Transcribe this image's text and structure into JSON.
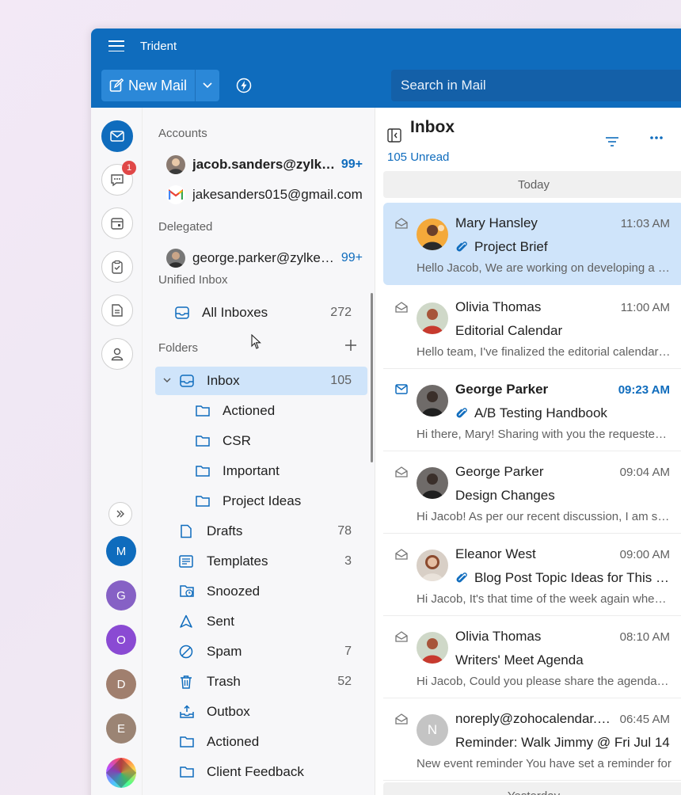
{
  "app": {
    "title": "Trident"
  },
  "toolbar": {
    "new_mail_label": "New Mail",
    "search_placeholder": "Search in Mail"
  },
  "rail": {
    "chat_badge": "1"
  },
  "rail_accounts": [
    {
      "letter": "M",
      "color": "#0f6cbd"
    },
    {
      "letter": "G",
      "color": "#8661c5"
    },
    {
      "letter": "O",
      "color": "#8a4ad3"
    },
    {
      "letter": "D",
      "color": "#a07f6e"
    },
    {
      "letter": "E",
      "color": "#9b8474"
    }
  ],
  "accounts_section": {
    "title": "Accounts",
    "items": [
      {
        "name": "jacob.sanders@zylker.com",
        "count": "99+"
      },
      {
        "name": "jakesanders015@gmail.com",
        "count": ""
      }
    ]
  },
  "delegated_section": {
    "title": "Delegated",
    "items": [
      {
        "name": "george.parker@zylker.com",
        "count": "99+"
      }
    ]
  },
  "unified_section": {
    "title": "Unified Inbox",
    "all_inboxes": {
      "label": "All Inboxes",
      "count": "272"
    }
  },
  "folders_section": {
    "title": "Folders",
    "inbox": {
      "label": "Inbox",
      "count": "105"
    },
    "subfolders": [
      "Actioned",
      "CSR",
      "Important",
      "Project Ideas"
    ],
    "items": [
      {
        "label": "Drafts",
        "count": "78",
        "icon": "draft-icon"
      },
      {
        "label": "Templates",
        "count": "3",
        "icon": "template-icon"
      },
      {
        "label": "Snoozed",
        "count": "",
        "icon": "snooze-icon"
      },
      {
        "label": "Sent",
        "count": "",
        "icon": "sent-icon"
      },
      {
        "label": "Spam",
        "count": "7",
        "icon": "spam-icon"
      },
      {
        "label": "Trash",
        "count": "52",
        "icon": "trash-icon"
      },
      {
        "label": "Outbox",
        "count": "",
        "icon": "outbox-icon"
      },
      {
        "label": "Actioned",
        "count": "",
        "icon": "folder-icon"
      },
      {
        "label": "Client Feedback",
        "count": "",
        "icon": "folder-icon"
      }
    ]
  },
  "list": {
    "title": "Inbox",
    "unread": "105 Unread",
    "today_label": "Today",
    "yesterday_label": "Yesterday",
    "messages": [
      {
        "sender": "Mary Hansley",
        "time": "11:03 AM",
        "subject": "Project Brief",
        "preview": "Hello Jacob, We are working on developing a new project",
        "attachment": true,
        "unread": false,
        "selected": true
      },
      {
        "sender": "Olivia Thomas",
        "time": "11:00 AM",
        "subject": "Editorial Calendar",
        "preview": "Hello team, I've finalized the editorial calendar for",
        "attachment": false,
        "unread": false,
        "selected": false
      },
      {
        "sender": "George Parker",
        "time": "09:23 AM",
        "subject": "A/B Testing Handbook",
        "preview": "Hi there, Mary! Sharing with you the requested handbook",
        "attachment": true,
        "unread": true,
        "selected": false
      },
      {
        "sender": "George Parker",
        "time": "09:04 AM",
        "subject": "Design Changes",
        "preview": "Hi Jacob! As per our recent discussion, I am sharing",
        "attachment": false,
        "unread": false,
        "selected": false
      },
      {
        "sender": "Eleanor West",
        "time": "09:00 AM",
        "subject": "Blog Post Topic Ideas for This Week",
        "preview": "Hi Jacob, It's that time of the week again when we",
        "attachment": true,
        "unread": false,
        "selected": false
      },
      {
        "sender": "Olivia Thomas",
        "time": "08:10 AM",
        "subject": "Writers' Meet Agenda",
        "preview": "Hi Jacob, Could you please share the agenda for",
        "attachment": false,
        "unread": false,
        "selected": false
      },
      {
        "sender": "noreply@zohocalendar.com",
        "time": "06:45 AM",
        "subject": "Reminder: Walk Jimmy @ Fri Jul 14",
        "preview": "New event reminder You have set a reminder for",
        "attachment": false,
        "unread": false,
        "selected": false,
        "initial": "N"
      }
    ]
  }
}
